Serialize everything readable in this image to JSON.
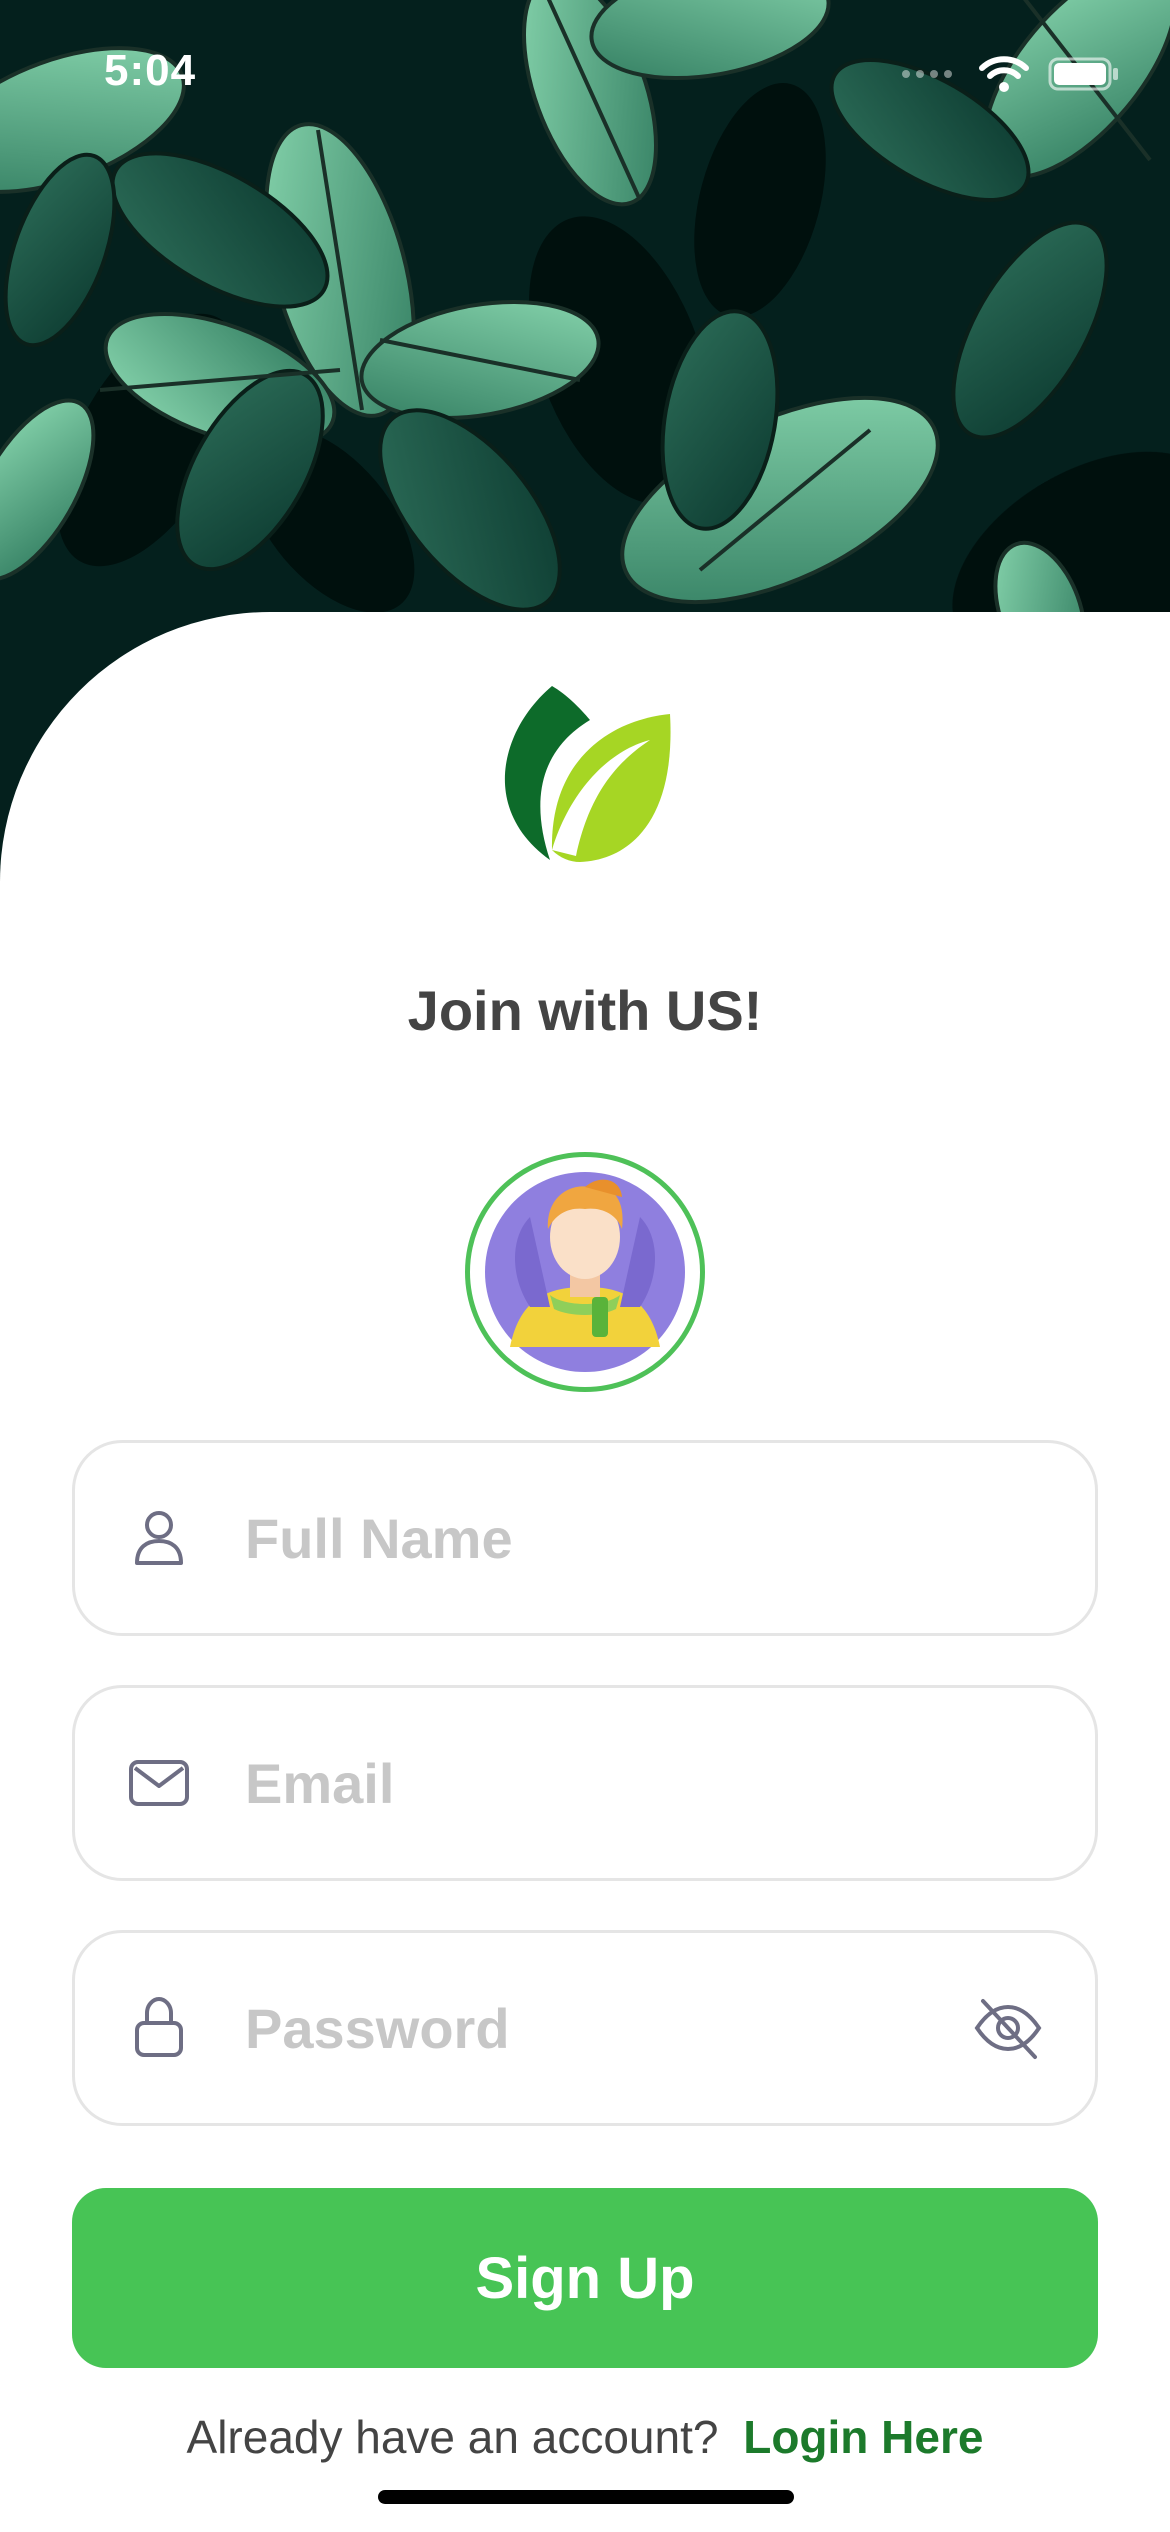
{
  "status_bar": {
    "time": "5:04",
    "icons": [
      "signal-icon",
      "wifi-icon",
      "battery-icon"
    ]
  },
  "header": {
    "title": "Join with US!"
  },
  "form": {
    "full_name": {
      "placeholder": "Full Name",
      "value": "",
      "icon": "person-icon"
    },
    "email": {
      "placeholder": "Email",
      "value": "",
      "icon": "mail-icon"
    },
    "password": {
      "placeholder": "Password",
      "value": "",
      "icon": "lock-icon",
      "toggle_icon": "eye-off-icon"
    }
  },
  "actions": {
    "signup_label": "Sign Up"
  },
  "footer": {
    "prompt": "Already have an account?",
    "link_label": "Login Here"
  },
  "colors": {
    "accent": "#47c455",
    "link": "#1c7a2b",
    "hero_bg": "#04201d",
    "leaf_light": "#6cc39a",
    "leaf_dark": "#1e5a48",
    "logo_dark_green": "#0d6b2a",
    "logo_light_green": "#a6d624"
  }
}
